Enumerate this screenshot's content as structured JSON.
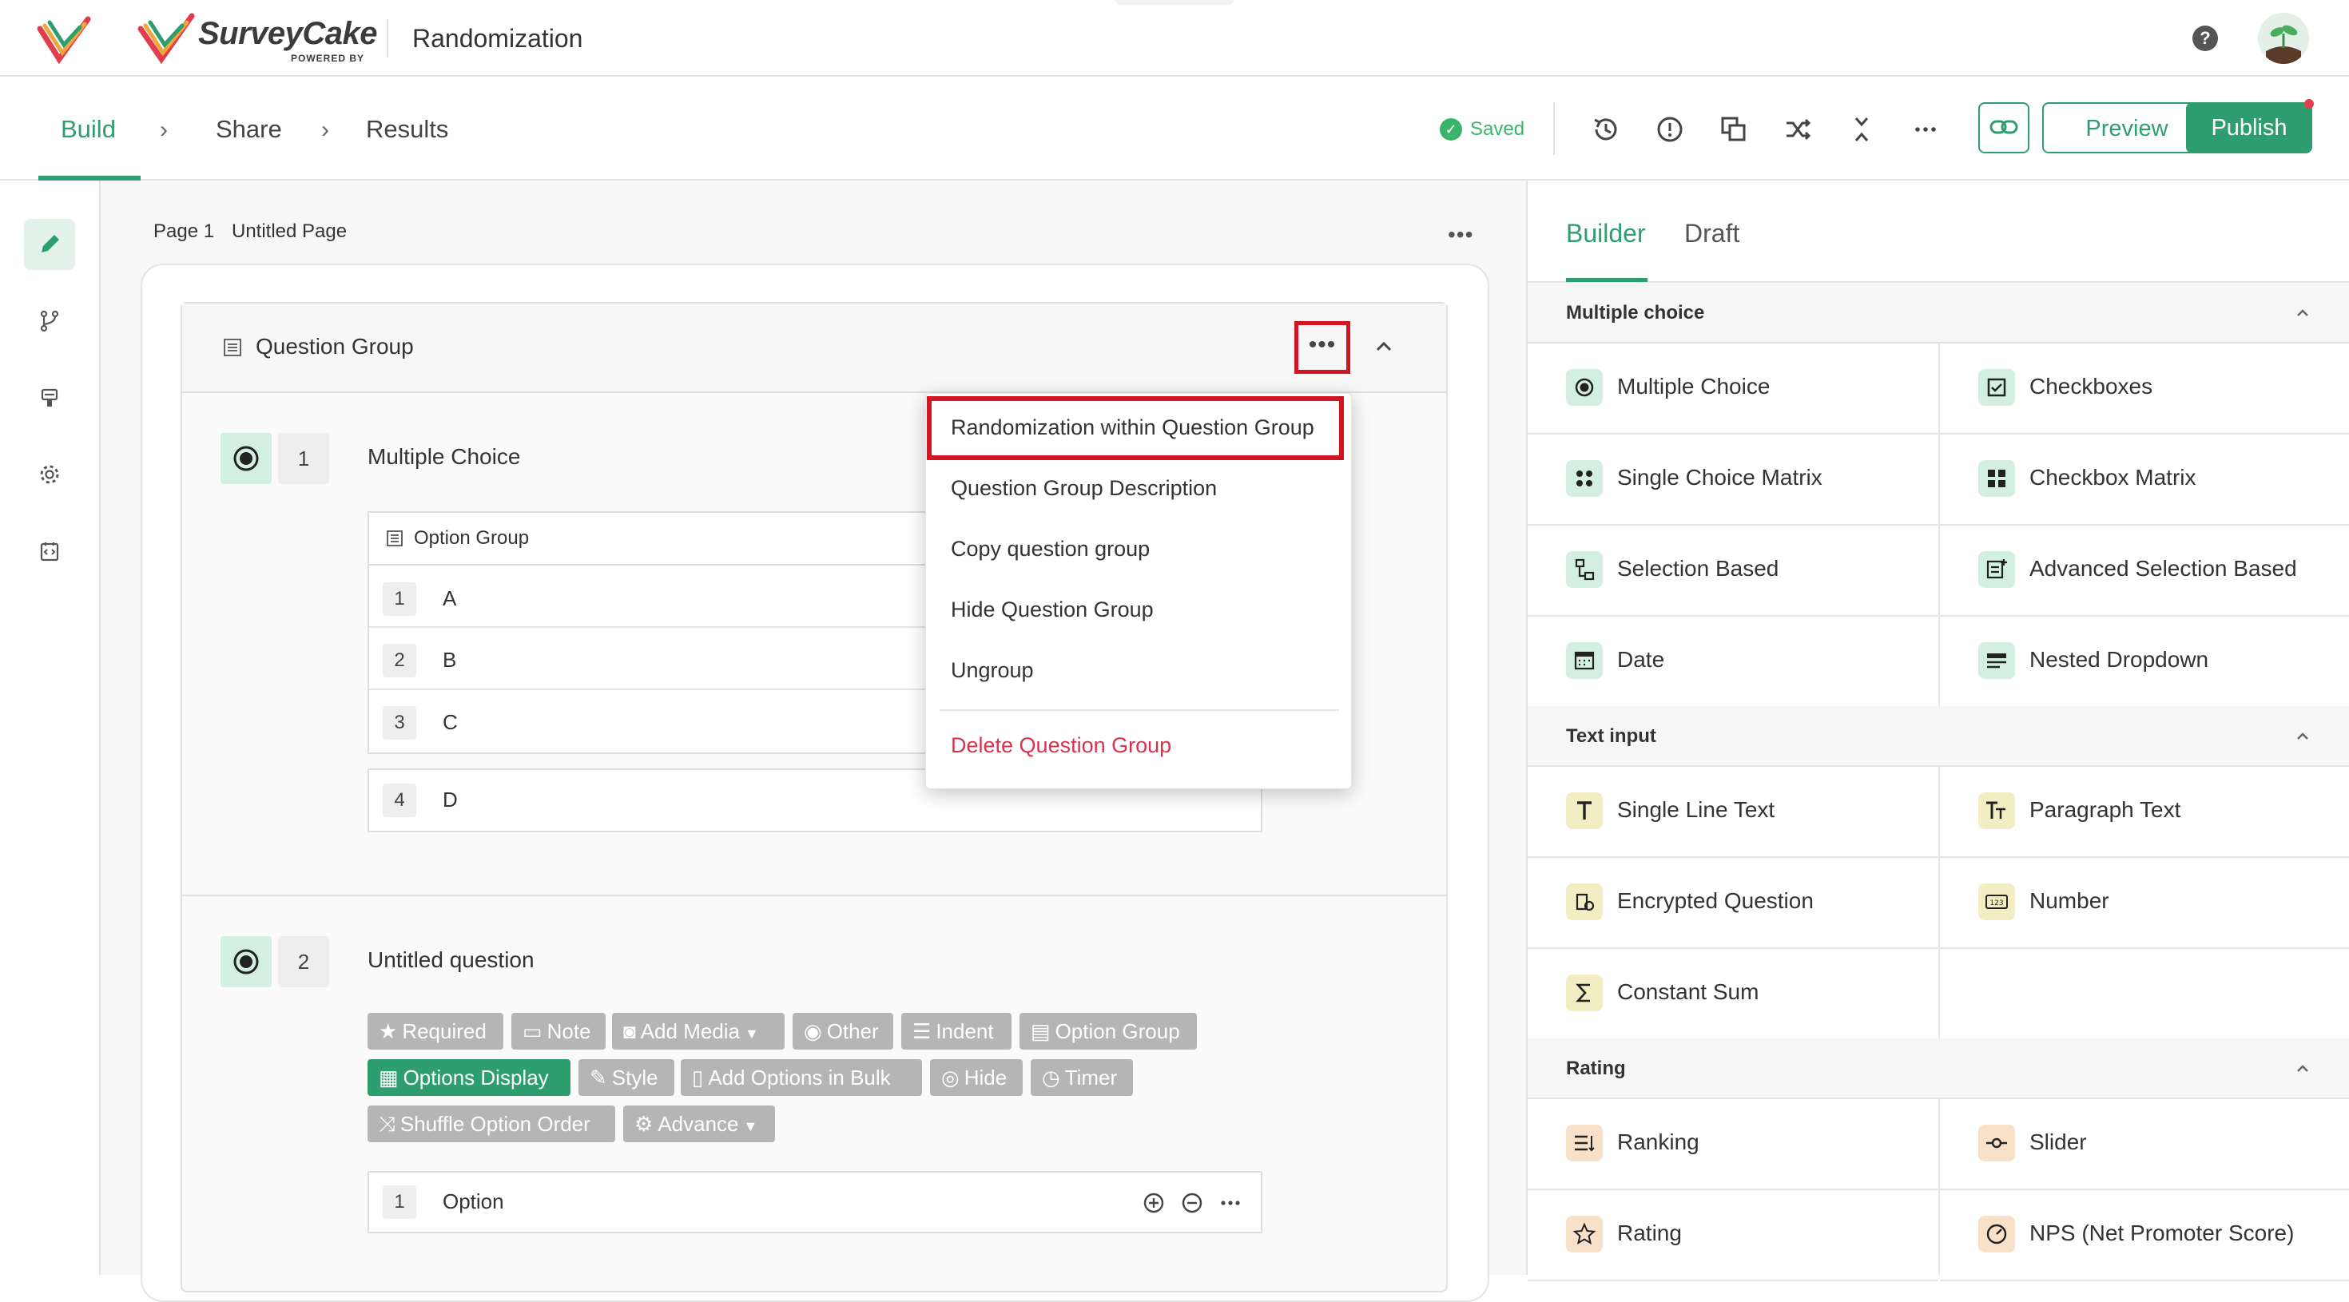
{
  "app": {
    "brand": "SurveyCake",
    "brand_sub": "POWERED BY",
    "title": "Randomization"
  },
  "nav": {
    "tabs": [
      "Build",
      "Share",
      "Results"
    ],
    "saved": "Saved",
    "preview": "Preview",
    "publish": "Publish"
  },
  "page": {
    "label": "Page 1",
    "name": "Untitled Page"
  },
  "group": {
    "title": "Question Group"
  },
  "questions": [
    {
      "number": "1",
      "title": "Multiple Choice",
      "option_group_title": "Option Group",
      "options": [
        {
          "num": "1",
          "text": "A"
        },
        {
          "num": "2",
          "text": "B"
        },
        {
          "num": "3",
          "text": "C"
        },
        {
          "num": "4",
          "text": "D"
        }
      ]
    },
    {
      "number": "2",
      "title": "Untitled question",
      "chips": [
        "Required",
        "Note",
        "Add Media",
        "Other",
        "Indent",
        "Option Group",
        "Options Display",
        "Style",
        "Add Options in Bulk",
        "Hide",
        "Timer",
        "Shuffle Option Order",
        "Advance"
      ],
      "options": [
        {
          "num": "1",
          "text": "Option"
        }
      ]
    }
  ],
  "dropdown": {
    "items": [
      "Randomization within Question Group",
      "Question Group Description",
      "Copy question group",
      "Hide Question Group",
      "Ungroup",
      "Delete Question Group"
    ]
  },
  "panel": {
    "tabs": [
      "Builder",
      "Draft"
    ],
    "sections": [
      {
        "title": "Multiple choice",
        "items": [
          "Multiple Choice",
          "Checkboxes",
          "Single Choice Matrix",
          "Checkbox Matrix",
          "Selection Based",
          "Advanced Selection Based",
          "Date",
          "Nested Dropdown"
        ]
      },
      {
        "title": "Text input",
        "items": [
          "Single Line Text",
          "Paragraph Text",
          "Encrypted Question",
          "Number",
          "Constant Sum"
        ]
      },
      {
        "title": "Rating",
        "items": [
          "Ranking",
          "Slider",
          "Rating",
          "NPS (Net Promoter Score)"
        ]
      }
    ]
  },
  "colors": {
    "accent": "#2f9e6e",
    "highlight": "#d01622",
    "danger": "#d8334d",
    "chip": "#b5b5b5"
  }
}
